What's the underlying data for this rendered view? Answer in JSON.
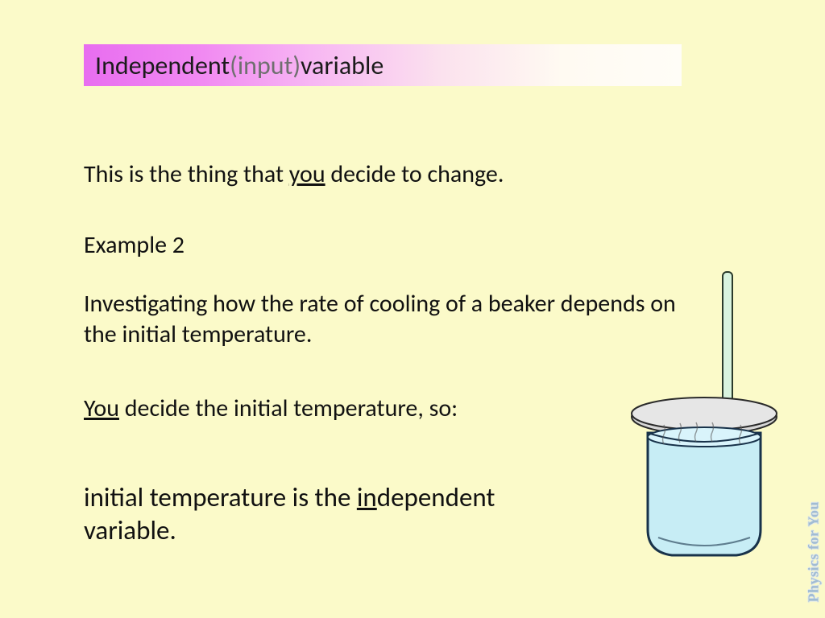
{
  "title": {
    "lead": "Independent ",
    "paren": "(input)",
    "trail": " variable"
  },
  "lines": {
    "intro_pre": "This is the thing that ",
    "intro_you": "you",
    "intro_post": " decide to change.",
    "example_label": "Example 2",
    "example_text": "Investigating how the rate of cooling of a beaker depends on the initial temperature.",
    "decide_pre_u": "You",
    "decide_post": " decide the initial temperature, so:",
    "concl_pre": "initial temperature is the ",
    "concl_u": "in",
    "concl_mid": "dependent variable."
  },
  "watermark": "Physics for You",
  "icons": {
    "beaker": "beaker-with-thermometer"
  }
}
